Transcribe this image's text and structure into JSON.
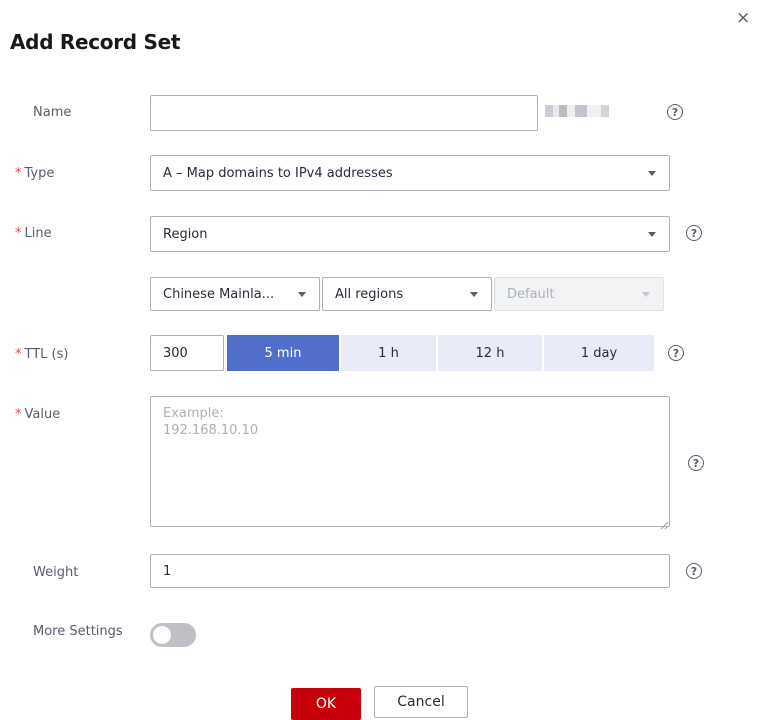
{
  "dialog": {
    "title": "Add Record Set",
    "close_glyph": "×",
    "help_glyph": "?",
    "required_mark": "*"
  },
  "form": {
    "name": {
      "label": "Name",
      "value": "",
      "suffix": "domain name (redacted)"
    },
    "type": {
      "label": "Type",
      "selected": "A – Map domains to IPv4 addresses"
    },
    "line": {
      "label": "Line",
      "selected": "Region",
      "sub_selects": [
        {
          "selected": "Chinese Mainla..."
        },
        {
          "selected": "All regions"
        },
        {
          "selected": "Default",
          "disabled": true
        }
      ]
    },
    "ttl": {
      "label": "TTL (s)",
      "value": "300",
      "presets": [
        {
          "label": "5 min",
          "active": true
        },
        {
          "label": "1 h",
          "active": false
        },
        {
          "label": "12 h",
          "active": false
        },
        {
          "label": "1 day",
          "active": false
        }
      ]
    },
    "value": {
      "label": "Value",
      "placeholder": "Example:\n192.168.10.10"
    },
    "weight": {
      "label": "Weight",
      "value": "1"
    },
    "more_settings": {
      "label": "More Settings",
      "enabled": false
    }
  },
  "footer": {
    "ok_label": "OK",
    "cancel_label": "Cancel"
  },
  "colors": {
    "primary": "#526ecc",
    "danger": "#c7000b",
    "required": "#e54545",
    "border": "#adb0b8"
  },
  "icons": [
    "close-icon",
    "help-icon",
    "chevron-down-icon",
    "resize-grip-icon"
  ]
}
